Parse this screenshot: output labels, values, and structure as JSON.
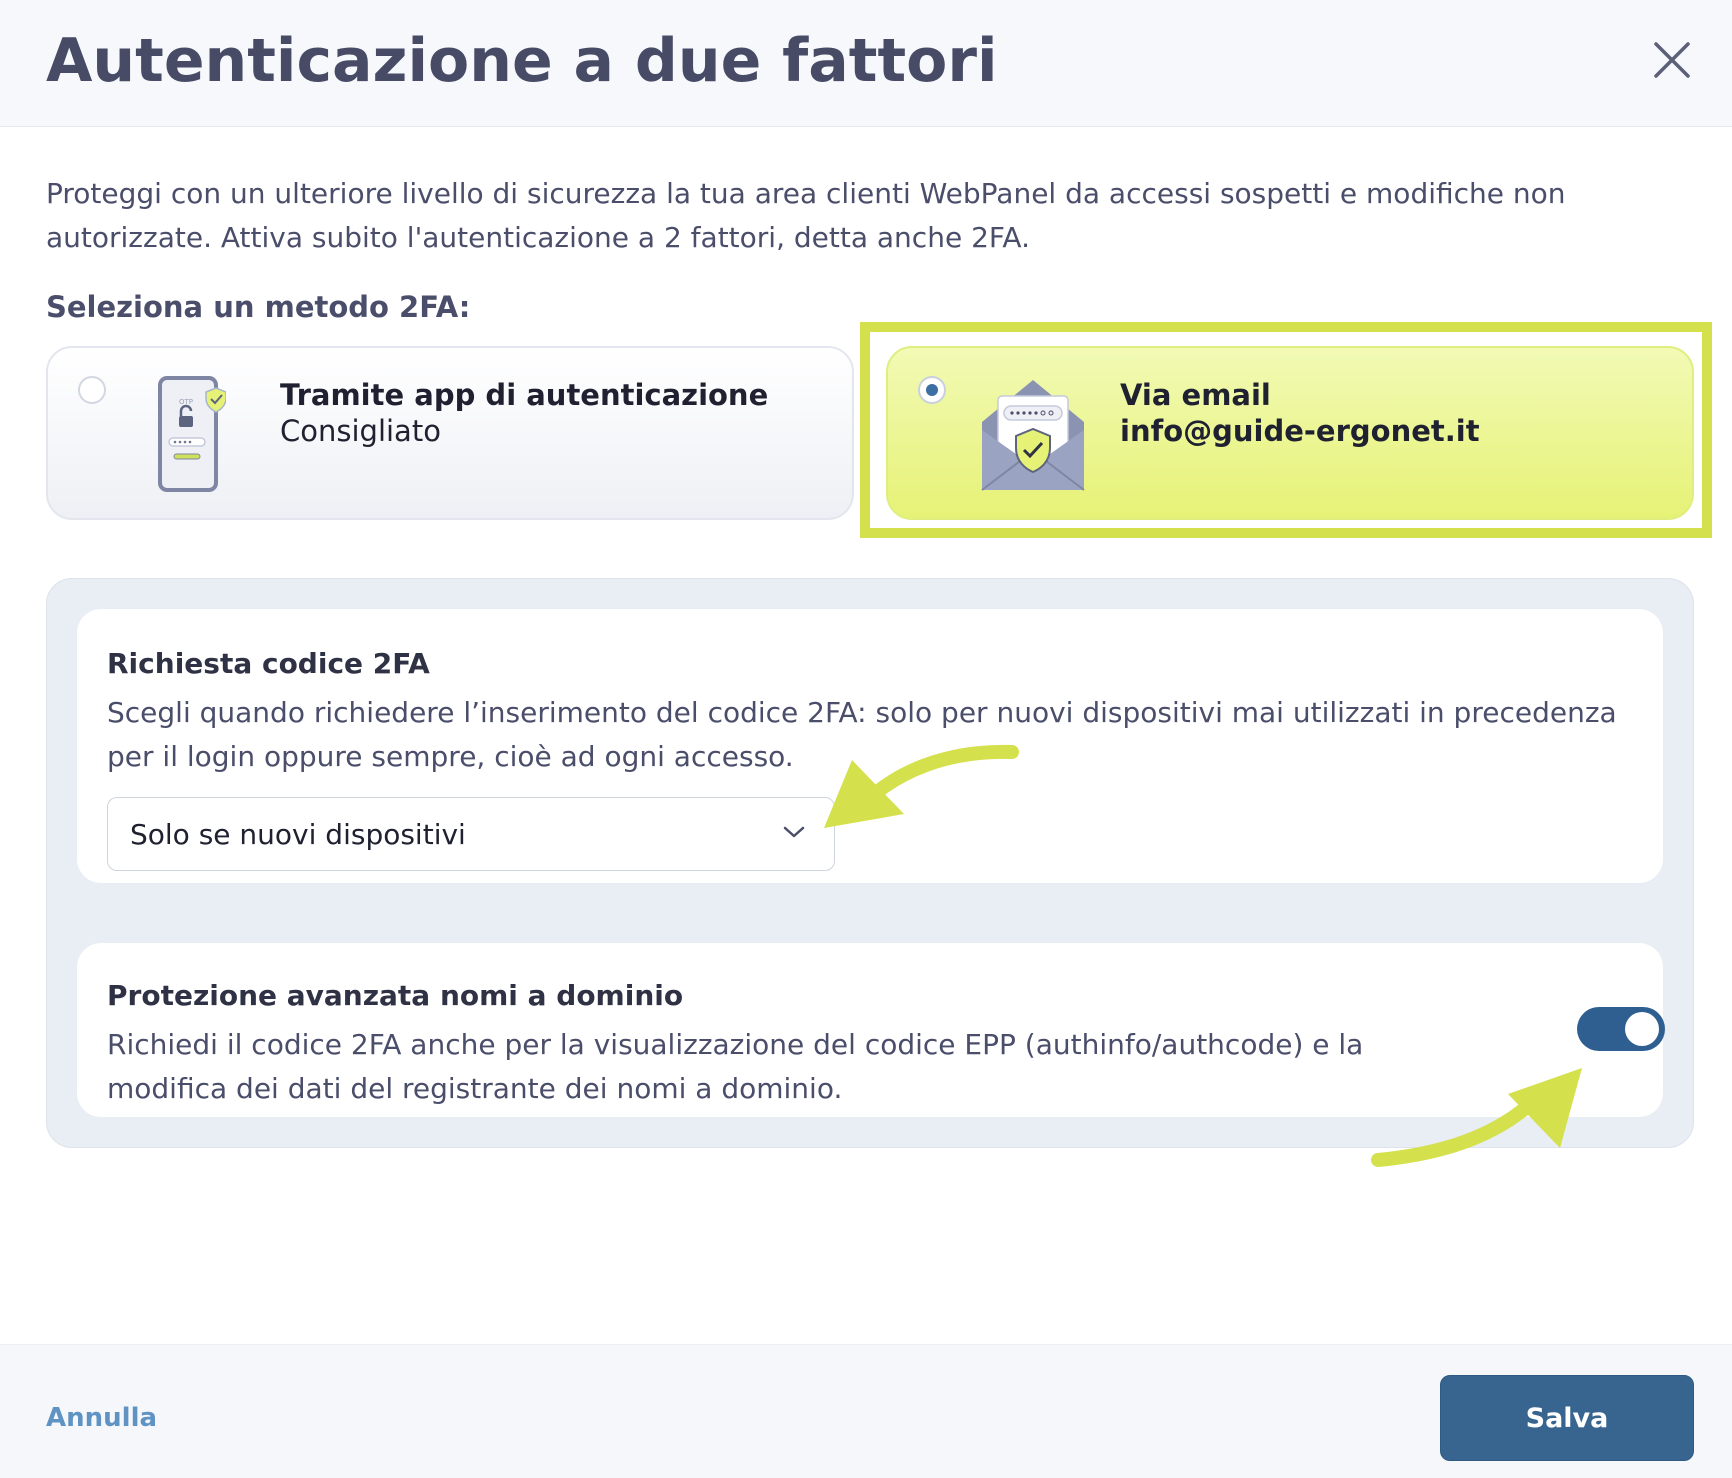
{
  "dialog": {
    "title": "Autenticazione a due fattori",
    "close_icon": "close-icon"
  },
  "intro": {
    "text": "Proteggi con un ulteriore livello di sicurezza la tua area clienti WebPanel da accessi sospetti e modifiche non autorizzate. Attiva subito l'autenticazione a 2 fattori, detta anche 2FA."
  },
  "methods": {
    "label": "Seleziona un metodo 2FA:",
    "options": [
      {
        "title": "Tramite app di autenticazione",
        "subtitle": "Consigliato",
        "icon": "phone-otp-icon",
        "selected": false
      },
      {
        "title": "Via email",
        "subtitle": "info@guide-ergonet.it",
        "icon": "email-shield-icon",
        "selected": true
      }
    ]
  },
  "code_request": {
    "title": "Richiesta codice 2FA",
    "description": "Scegli quando richiedere l’inserimento del codice 2FA: solo per nuovi dispositivi mai utilizzati in precedenza per il login oppure sempre, cioè ad ogni accesso.",
    "selected_value": "Solo se nuovi dispositivi"
  },
  "domain_protection": {
    "title": "Protezione avanzata nomi a dominio",
    "description": "Richiedi il codice 2FA anche per la visualizzazione del codice EPP (authinfo/authcode) e la modifica dei dati del registrante dei nomi a dominio.",
    "enabled": true
  },
  "footer": {
    "cancel_label": "Annulla",
    "save_label": "Salva"
  },
  "colors": {
    "accent": "#386590",
    "highlight": "#d4e04c",
    "selected_option_bg": "#e6f276"
  }
}
